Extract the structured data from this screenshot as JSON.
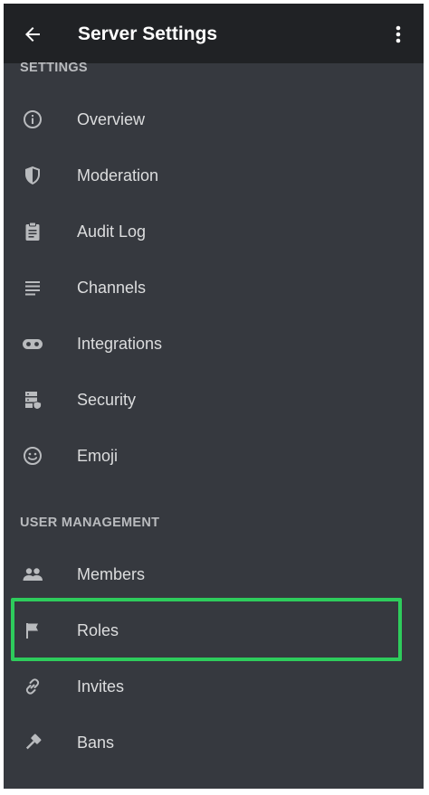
{
  "header": {
    "title": "Server Settings"
  },
  "sections": [
    {
      "title": "SETTINGS",
      "items": [
        {
          "label": "Overview",
          "icon": "info-icon"
        },
        {
          "label": "Moderation",
          "icon": "shield-icon"
        },
        {
          "label": "Audit Log",
          "icon": "clipboard-icon"
        },
        {
          "label": "Channels",
          "icon": "list-icon"
        },
        {
          "label": "Integrations",
          "icon": "gamepad-icon"
        },
        {
          "label": "Security",
          "icon": "server-lock-icon"
        },
        {
          "label": "Emoji",
          "icon": "smiley-icon"
        }
      ]
    },
    {
      "title": "USER MANAGEMENT",
      "items": [
        {
          "label": "Members",
          "icon": "people-icon"
        },
        {
          "label": "Roles",
          "icon": "flag-icon"
        },
        {
          "label": "Invites",
          "icon": "link-icon"
        },
        {
          "label": "Bans",
          "icon": "hammer-icon"
        }
      ]
    }
  ],
  "colors": {
    "background": "#36393f",
    "topbar": "#202225",
    "text": "#dcddde",
    "section_header": "#b9bbbe",
    "icon": "#b9bbbe",
    "highlight": "#2ecc5c"
  }
}
